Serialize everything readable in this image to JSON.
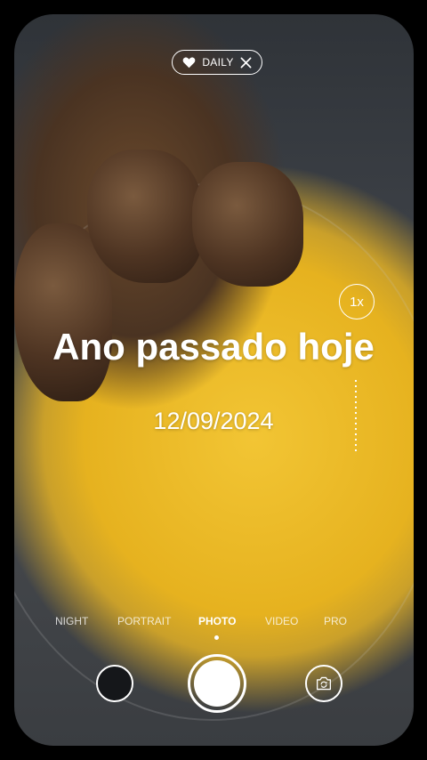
{
  "badge": {
    "icon": "heart-icon",
    "label": "DAILY",
    "close_icon": "close-icon"
  },
  "zoom": {
    "label": "1x"
  },
  "memory": {
    "title": "Ano passado hoje",
    "date": "12/09/2024"
  },
  "modes": [
    {
      "label": "NIGHT"
    },
    {
      "label": "PORTRAIT"
    },
    {
      "label": "PHOTO",
      "active": true
    },
    {
      "label": "VIDEO"
    },
    {
      "label": "PRO"
    }
  ],
  "controls": {
    "gallery_icon": "gallery-thumbnail",
    "shutter_icon": "shutter-icon",
    "switch_icon": "switch-camera-icon"
  }
}
